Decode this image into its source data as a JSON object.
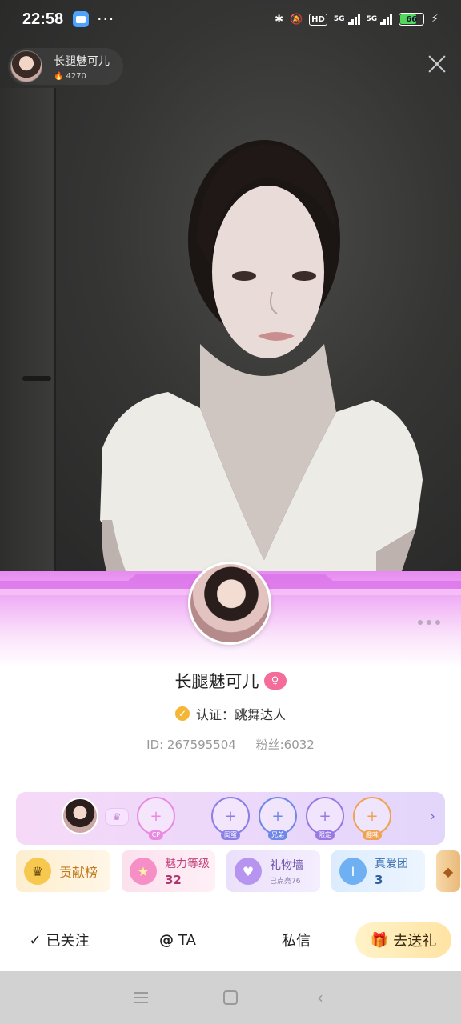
{
  "status_bar": {
    "time": "22:58",
    "hd_label": "HD",
    "network_a": "5G",
    "network_b": "5G",
    "battery": "66",
    "icons": [
      "bluetooth-icon",
      "mute-icon",
      "signal-icon",
      "charging-icon"
    ]
  },
  "host": {
    "name": "长腿魅可儿",
    "popularity": "4270"
  },
  "profile": {
    "name": "长腿魅可儿",
    "verify_label": "认证：跳舞达人",
    "id_text": "ID: 267595504",
    "fans_text": "粉丝:6032"
  },
  "relations": {
    "slots": [
      {
        "tag": "CP",
        "color": "#e98ae0"
      },
      {
        "tag": "闺蜜",
        "color": "#8a7fe6"
      },
      {
        "tag": "兄弟",
        "color": "#6f88e8"
      },
      {
        "tag": "限定",
        "color": "#9a78e3"
      },
      {
        "tag": "趣味",
        "color": "#f0a253"
      }
    ],
    "plus": "+"
  },
  "cards": {
    "contribution": "贡献榜",
    "charm_label": "魅力等级",
    "charm_value": "32",
    "gift_wall_label": "礼物墙",
    "gift_wall_sub": "已点亮76",
    "fan_club_label": "真爱团",
    "fan_club_value": "3"
  },
  "actions": {
    "followed": "已关注",
    "mention": "TA",
    "message": "私信",
    "send_gift": "去送礼"
  },
  "colors": {
    "accent_pink": "#e68bf0",
    "gender_badge": "#f36c9a",
    "verify_gold": "#f3b636",
    "gift_button": "#ffe3a3"
  }
}
